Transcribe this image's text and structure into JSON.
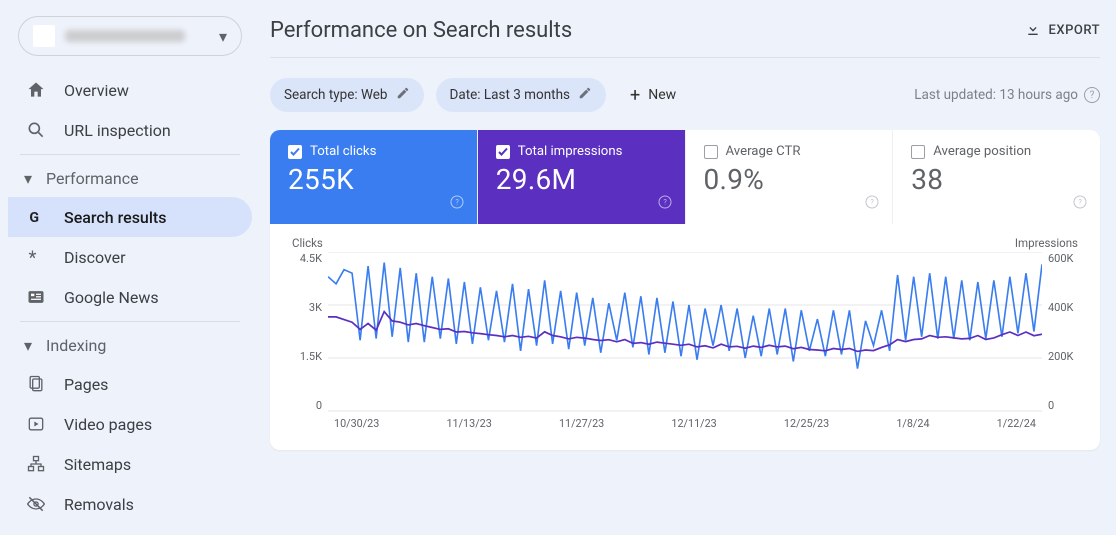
{
  "sidebar": {
    "top": {
      "overview": "Overview",
      "url_inspection": "URL inspection"
    },
    "performance": {
      "section": "Performance",
      "search_results": "Search results",
      "discover": "Discover",
      "google_news": "Google News"
    },
    "indexing": {
      "section": "Indexing",
      "pages": "Pages",
      "video_pages": "Video pages",
      "sitemaps": "Sitemaps",
      "removals": "Removals"
    }
  },
  "header": {
    "title": "Performance on Search results",
    "export": "EXPORT"
  },
  "filters": {
    "search_type": "Search type: Web",
    "date": "Date: Last 3 months",
    "new": "New",
    "updated": "Last updated: 13 hours ago"
  },
  "metrics": {
    "clicks": {
      "label": "Total clicks",
      "value": "255K"
    },
    "impressions": {
      "label": "Total impressions",
      "value": "29.6M"
    },
    "ctr": {
      "label": "Average CTR",
      "value": "0.9%"
    },
    "position": {
      "label": "Average position",
      "value": "38"
    }
  },
  "chart": {
    "left_title": "Clicks",
    "right_title": "Impressions",
    "left_ticks": [
      "4.5K",
      "3K",
      "1.5K",
      "0"
    ],
    "right_ticks": [
      "600K",
      "400K",
      "200K",
      "0"
    ]
  },
  "chart_data": {
    "type": "line",
    "xlabel": "",
    "ylabel_left": "Clicks",
    "ylabel_right": "Impressions",
    "left_ylim": [
      0,
      4500
    ],
    "right_ylim": [
      0,
      600000
    ],
    "x_ticks": [
      "10/30/23",
      "11/13/23",
      "11/27/23",
      "12/11/23",
      "12/25/23",
      "1/8/24",
      "1/22/24"
    ],
    "series": [
      {
        "name": "Clicks",
        "axis": "left",
        "color": "#3a7df0",
        "values": [
          3800,
          3600,
          4000,
          3900,
          2000,
          4100,
          2050,
          4200,
          2100,
          4050,
          1950,
          3900,
          1950,
          3800,
          2050,
          3750,
          1900,
          3650,
          1900,
          3500,
          2000,
          3400,
          1950,
          3600,
          1700,
          3450,
          1850,
          3700,
          1900,
          3400,
          1750,
          3350,
          1850,
          3200,
          1650,
          3050,
          2000,
          3350,
          1800,
          3250,
          1600,
          3200,
          1650,
          3100,
          1550,
          3000,
          1450,
          2900,
          1850,
          3000,
          1700,
          2900,
          1500,
          2700,
          1550,
          2900,
          1600,
          2900,
          1400,
          2850,
          1700,
          2600,
          1550,
          2850,
          1600,
          2850,
          1200,
          2550,
          1850,
          2850,
          1700,
          3850,
          2000,
          3800,
          2100,
          3900,
          2050,
          3800,
          2050,
          3700,
          2000,
          3650,
          2050,
          3700,
          2100,
          3800,
          2200,
          3900,
          2250,
          4150
        ]
      },
      {
        "name": "Impressions",
        "axis": "right",
        "color": "#5b2fc0",
        "values": [
          355000,
          355000,
          345000,
          335000,
          308000,
          330000,
          305000,
          375000,
          340000,
          335000,
          325000,
          330000,
          322000,
          315000,
          308000,
          310000,
          298000,
          300000,
          295000,
          292000,
          288000,
          285000,
          280000,
          285000,
          278000,
          282000,
          275000,
          299000,
          285000,
          280000,
          272000,
          278000,
          275000,
          270000,
          266000,
          269000,
          261000,
          270000,
          255000,
          258000,
          252000,
          260000,
          256000,
          252000,
          248000,
          252000,
          242000,
          246000,
          238000,
          252000,
          242000,
          244000,
          237000,
          245000,
          240000,
          248000,
          242000,
          245000,
          235000,
          240000,
          232000,
          230000,
          227000,
          236000,
          232000,
          236000,
          225000,
          230000,
          228000,
          240000,
          250000,
          270000,
          262000,
          270000,
          272000,
          285000,
          278000,
          280000,
          276000,
          272000,
          274000,
          285000,
          270000,
          276000,
          288000,
          298000,
          285000,
          298000,
          284000,
          290000
        ]
      }
    ]
  }
}
